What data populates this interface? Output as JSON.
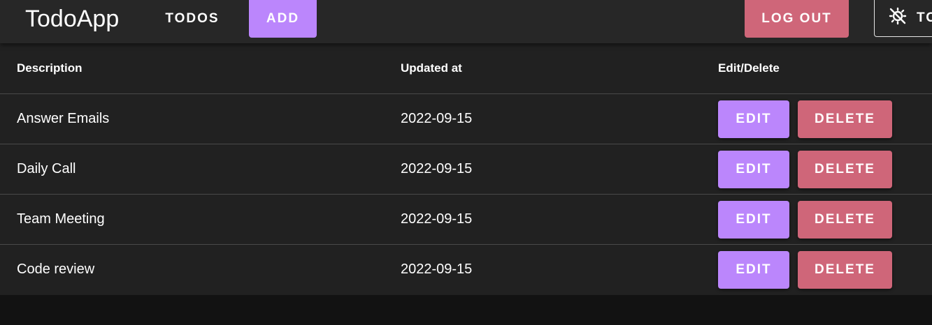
{
  "app": {
    "title": "TodoApp"
  },
  "nav": {
    "todos_label": "TODOS",
    "add_label": "ADD",
    "logout_label": "LOG OUT",
    "theme_toggle_label": "TO",
    "theme_toggle_icon": "theme-toggle-icon"
  },
  "colors": {
    "appbar": "#272727",
    "table": "#212121",
    "background": "#121212",
    "primary": "#bb86fc",
    "danger": "#cf6679"
  },
  "table": {
    "headers": {
      "description": "Description",
      "updated_at": "Updated at",
      "actions": "Edit/Delete"
    },
    "edit_label": "EDIT",
    "delete_label": "DELETE",
    "rows": [
      {
        "description": "Answer Emails",
        "updated_at": "2022-09-15"
      },
      {
        "description": "Daily Call",
        "updated_at": "2022-09-15"
      },
      {
        "description": "Team Meeting",
        "updated_at": "2022-09-15"
      },
      {
        "description": "Code review",
        "updated_at": "2022-09-15"
      }
    ]
  }
}
